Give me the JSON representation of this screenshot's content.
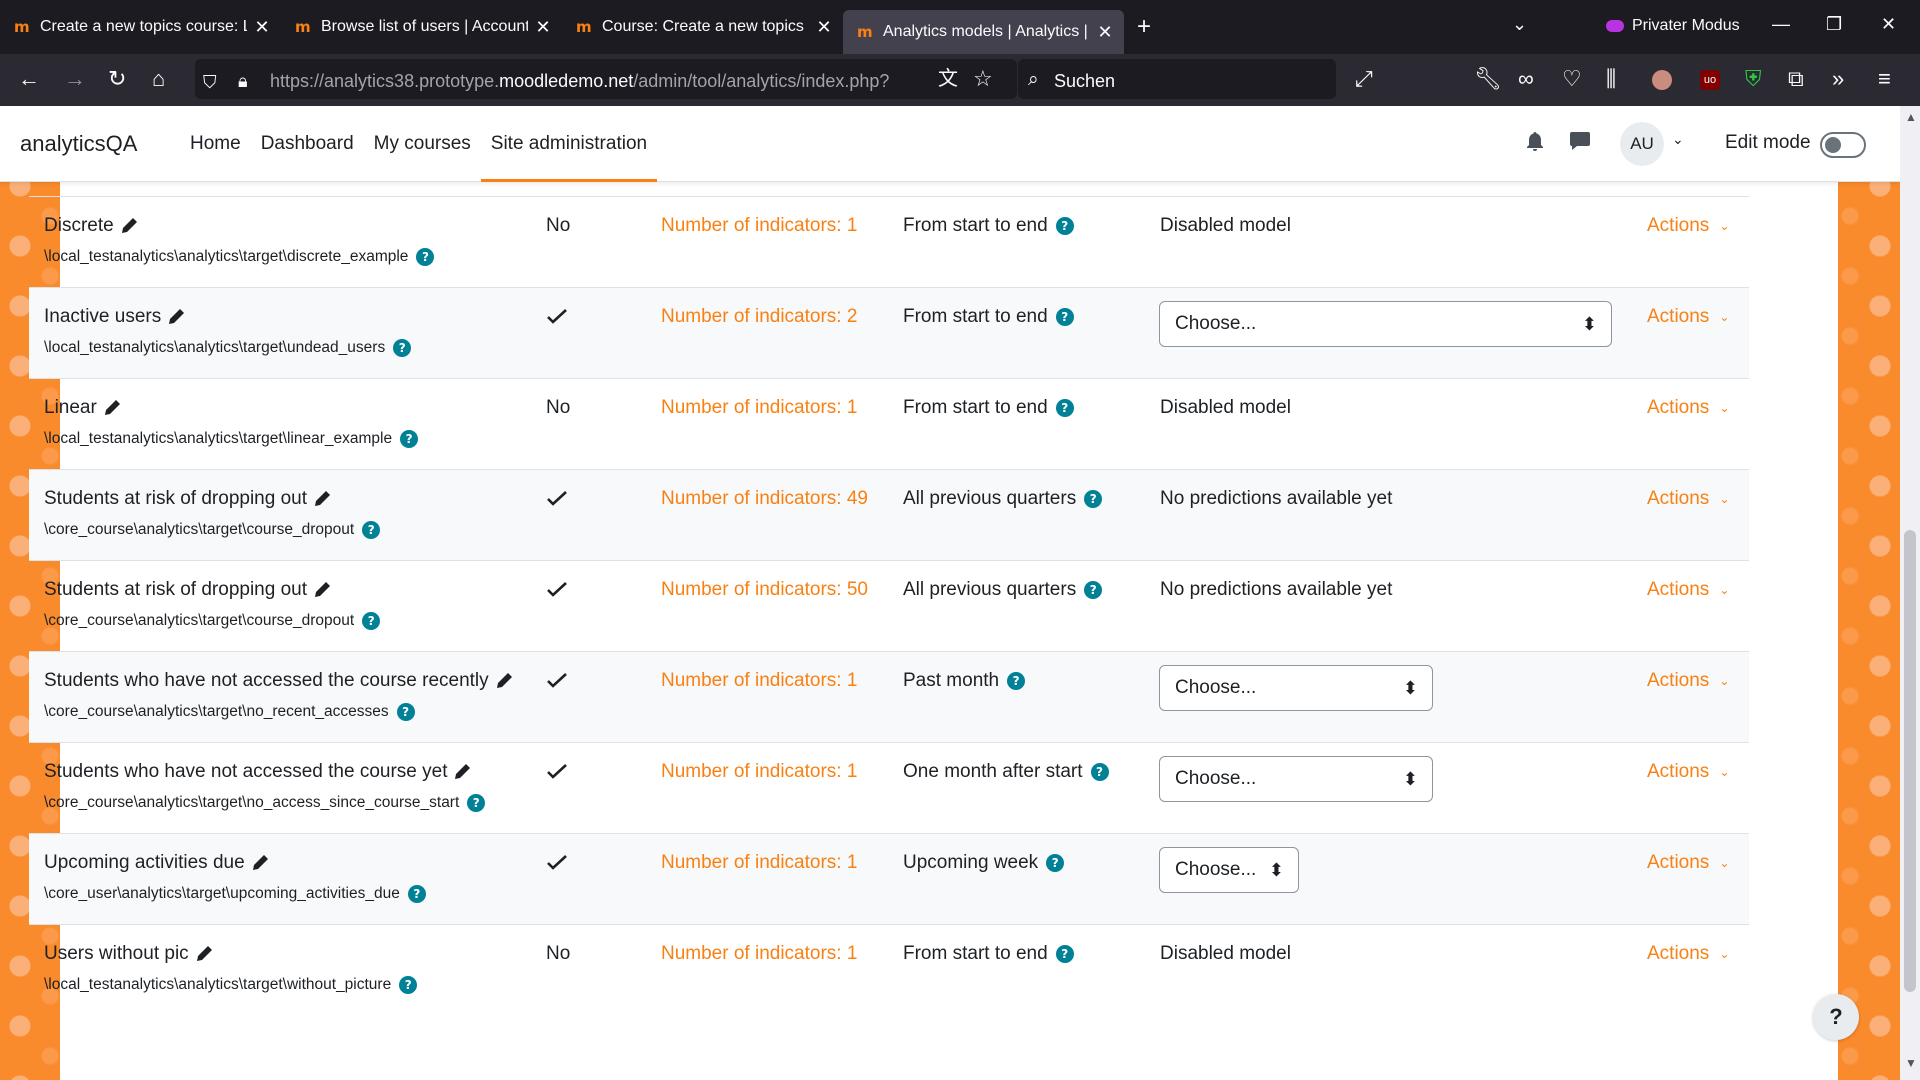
{
  "browser": {
    "tabs": [
      {
        "title": "Create a new topics course: Log",
        "active": false
      },
      {
        "title": "Browse list of users | Accounts |",
        "active": false
      },
      {
        "title": "Course: Create a new topics cou",
        "active": false
      },
      {
        "title": "Analytics models | Analytics | A",
        "active": true
      }
    ],
    "private_mode_label": "Privater Modus",
    "url_prefix": "https://analytics38.prototype.",
    "url_domain": "moodledemo.net",
    "url_path": "/admin/tool/analytics/index.php?",
    "search_placeholder": "Suchen"
  },
  "site": {
    "brand": "analyticsQA",
    "nav": [
      "Home",
      "Dashboard",
      "My courses",
      "Site administration"
    ],
    "active_nav": "Site administration",
    "avatar_initials": "AU",
    "edit_mode_label": "Edit mode"
  },
  "models": [
    {
      "name": "Discrete",
      "target": "\\local_testanalytics\\analytics\\target\\discrete_example",
      "enabled": "No",
      "indicators": "Number of indicators: 1",
      "interval": "From start to end",
      "status_text": "Disabled model",
      "select": null,
      "actions": "Actions"
    },
    {
      "name": "Inactive users",
      "target": "\\local_testanalytics\\analytics\\target\\undead_users",
      "enabled": "check",
      "indicators": "Number of indicators: 2",
      "interval": "From start to end",
      "status_text": null,
      "select": "Choose...",
      "actions": "Actions"
    },
    {
      "name": "Linear",
      "target": "\\local_testanalytics\\analytics\\target\\linear_example",
      "enabled": "No",
      "indicators": "Number of indicators: 1",
      "interval": "From start to end",
      "status_text": "Disabled model",
      "select": null,
      "actions": "Actions"
    },
    {
      "name": "Students at risk of dropping out",
      "target": "\\core_course\\analytics\\target\\course_dropout",
      "enabled": "check",
      "indicators": "Number of indicators: 49",
      "interval": "All previous quarters",
      "status_text": "No predictions available yet",
      "select": null,
      "actions": "Actions"
    },
    {
      "name": "Students at risk of dropping out",
      "target": "\\core_course\\analytics\\target\\course_dropout",
      "enabled": "check",
      "indicators": "Number of indicators: 50",
      "interval": "All previous quarters",
      "status_text": "No predictions available yet",
      "select": null,
      "actions": "Actions"
    },
    {
      "name": "Students who have not accessed the course recently",
      "target": "\\core_course\\analytics\\target\\no_recent_accesses",
      "enabled": "check",
      "indicators": "Number of indicators: 1",
      "interval": "Past month",
      "status_text": null,
      "select": "Choose...",
      "actions": "Actions"
    },
    {
      "name": "Students who have not accessed the course yet",
      "target": "\\core_course\\analytics\\target\\no_access_since_course_start",
      "enabled": "check",
      "indicators": "Number of indicators: 1",
      "interval": "One month after start",
      "status_text": null,
      "select": "Choose...",
      "actions": "Actions"
    },
    {
      "name": "Upcoming activities due",
      "target": "\\core_user\\analytics\\target\\upcoming_activities_due",
      "enabled": "check",
      "indicators": "Number of indicators: 1",
      "interval": "Upcoming week",
      "status_text": null,
      "select": "Choose...",
      "actions": "Actions"
    },
    {
      "name": "Users without pic",
      "target": "\\local_testanalytics\\analytics\\target\\without_picture",
      "enabled": "No",
      "indicators": "Number of indicators: 1",
      "interval": "From start to end",
      "status_text": "Disabled model",
      "select": null,
      "actions": "Actions"
    }
  ],
  "help_button": "?",
  "colors": {
    "brand": "#f98012",
    "help_icon": "#008196",
    "browser_dark": "#1c1b22"
  }
}
